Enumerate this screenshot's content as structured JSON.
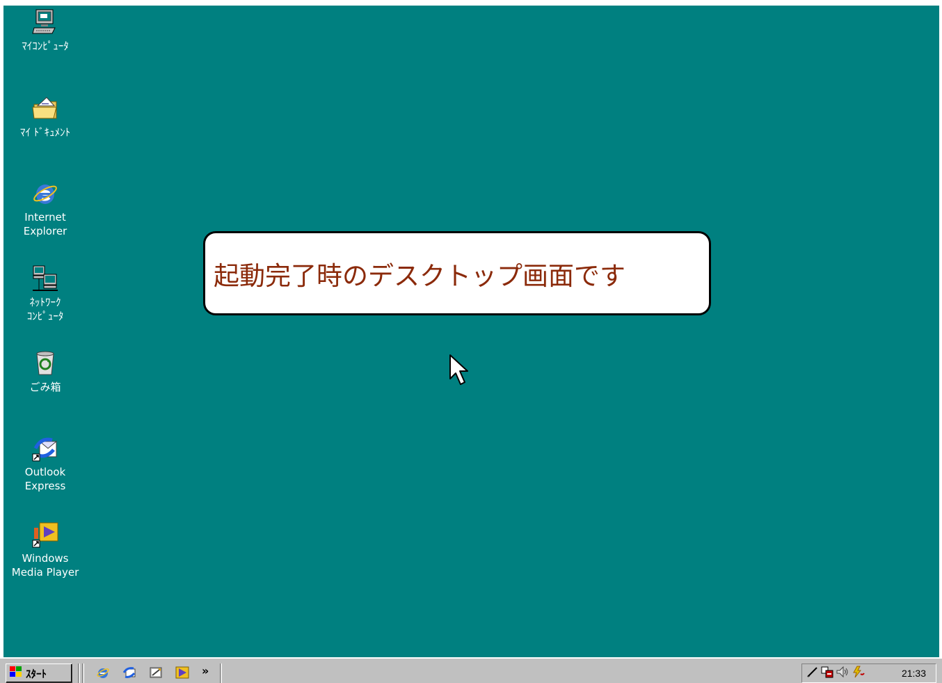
{
  "desktop": {
    "background_color": "#008080",
    "icons": [
      {
        "name": "my-computer",
        "label": "ﾏｲｺﾝﾋﾟｭｰﾀ"
      },
      {
        "name": "my-documents",
        "label": "ﾏｲ ﾄﾞｷｭﾒﾝﾄ"
      },
      {
        "name": "internet-explorer",
        "label": "Internet\nExplorer"
      },
      {
        "name": "network-computers",
        "label": "ﾈｯﾄﾜｰｸ\nｺﾝﾋﾟｭｰﾀ"
      },
      {
        "name": "recycle-bin",
        "label": "ごみ箱"
      },
      {
        "name": "outlook-express",
        "label": "Outlook\nExpress"
      },
      {
        "name": "windows-media-player",
        "label": "Windows\nMedia Player"
      }
    ]
  },
  "callout": {
    "text": "起動完了時のデスクトップ画面です",
    "text_color": "#8b2a0a"
  },
  "taskbar": {
    "start_label": "ｽﾀｰﾄ",
    "quick_launch": [
      "internet-explorer-icon",
      "outlook-express-icon",
      "desktop-icon",
      "windows-media-player-icon"
    ],
    "more_label": "»",
    "clock": "21:33",
    "tray_icons": [
      "pen-icon",
      "ime-icon",
      "volume-icon",
      "power-icon"
    ]
  }
}
